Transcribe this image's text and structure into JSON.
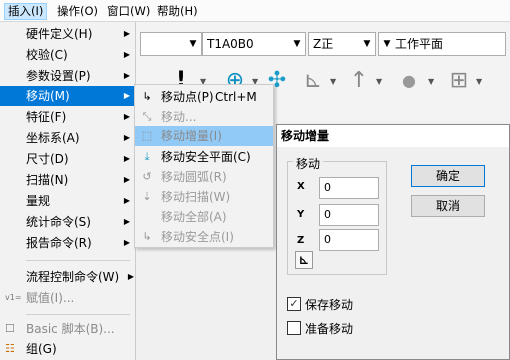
{
  "menubar": {
    "items": [
      "插入(I)",
      "操作(O)",
      "窗口(W)",
      "帮助(H)"
    ]
  },
  "toolbar": {
    "combo1": "",
    "combo2": "T1A0B0",
    "combo3": "Z正",
    "combo4": "工作平面"
  },
  "main_menu": {
    "items": [
      {
        "label": "硬件定义(H)",
        "submenu": true
      },
      {
        "label": "校验(C)",
        "submenu": true
      },
      {
        "label": "参数设置(P)",
        "submenu": true
      },
      {
        "label": "移动(M)",
        "submenu": true,
        "selected": true
      },
      {
        "label": "特征(F)",
        "submenu": true
      },
      {
        "label": "坐标系(A)",
        "submenu": true
      },
      {
        "label": "尺寸(D)",
        "submenu": true
      },
      {
        "label": "扫描(N)",
        "submenu": true
      },
      {
        "label": "量规",
        "submenu": true
      },
      {
        "label": "统计命令(S)",
        "submenu": true
      },
      {
        "label": "报告命令(R)",
        "submenu": true
      },
      {
        "label": "流程控制命令(W)",
        "submenu": true
      },
      {
        "label": "赋值(I)...",
        "disabled": true,
        "icon": "v1="
      },
      {
        "label": "Basic 脚本(B)...",
        "disabled": true,
        "icon": "☐"
      },
      {
        "label": "组(G)",
        "icon": "☷"
      }
    ]
  },
  "sub_menu": {
    "items": [
      {
        "label": "移动点(P)",
        "shortcut": "Ctrl+M",
        "icon": "↳"
      },
      {
        "label": "移动...",
        "disabled": true,
        "icon": "⤡"
      },
      {
        "label": "移动增量(I)",
        "disabled": true,
        "highlighted": true,
        "icon": "⬚"
      },
      {
        "label": "移动安全平面(C)",
        "icon": "⤓"
      },
      {
        "label": "移动圆弧(R)",
        "disabled": true,
        "icon": "↺"
      },
      {
        "label": "移动扫描(W)",
        "disabled": true,
        "icon": "⇣"
      },
      {
        "label": "移动全部(A)",
        "disabled": true,
        "icon": ""
      },
      {
        "label": "移动安全点(I)",
        "disabled": true,
        "icon": "↳"
      }
    ]
  },
  "dialog": {
    "title": "移动增量",
    "group_label": "移动",
    "x_label": "X",
    "x_value": "0",
    "y_label": "Y",
    "y_value": "0",
    "z_label": "Z",
    "z_value": "0",
    "ok_label": "确定",
    "cancel_label": "取消",
    "save_move_label": "保存移动",
    "save_move_checked": true,
    "prepare_move_label": "准备移动",
    "prepare_move_checked": false
  }
}
